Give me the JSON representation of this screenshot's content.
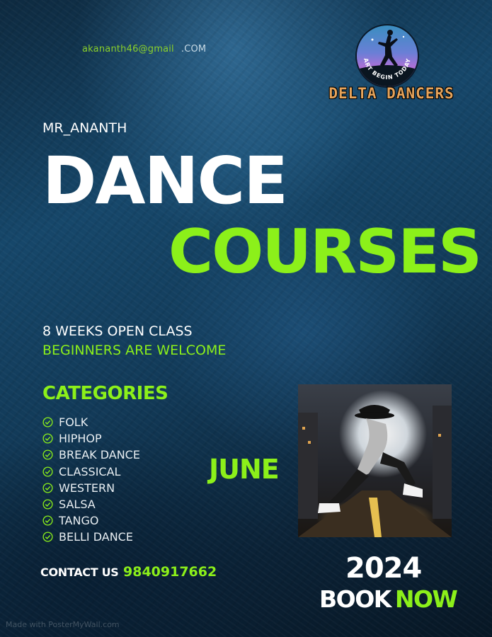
{
  "header": {
    "email_user": "akananth46@gmail",
    "email_domain": ".COM",
    "presenter": "MR_ANANTH"
  },
  "logo": {
    "arc_text": "ART BEGIN TODAY",
    "brand": "DELTA DANCERS"
  },
  "title": {
    "line1": "DANCE",
    "line2": "COURSES"
  },
  "info": {
    "duration": "8 WEEKS OPEN CLASS",
    "audience": "BEGINNERS ARE WELCOME"
  },
  "categories": {
    "heading": "CATEGORIES",
    "items": [
      "FOLK",
      "HIPHOP",
      "BREAK DANCE",
      "CLASSICAL",
      "WESTERN",
      "SALSA",
      "TANGO",
      "BELLI DANCE"
    ]
  },
  "schedule": {
    "month": "JUNE",
    "year": "2024"
  },
  "contact": {
    "label": "CONTACT US",
    "phone": "9840917662"
  },
  "cta": {
    "book": "BOOK",
    "now": "NOW"
  },
  "footer": {
    "watermark": "Made with PosterMyWall.com"
  },
  "colors": {
    "accent": "#8cf01a",
    "text": "#ffffff",
    "brand_text": "#e6a35a",
    "background": "#16476a"
  },
  "icons": {
    "category_bullet": "check-circle-icon"
  }
}
